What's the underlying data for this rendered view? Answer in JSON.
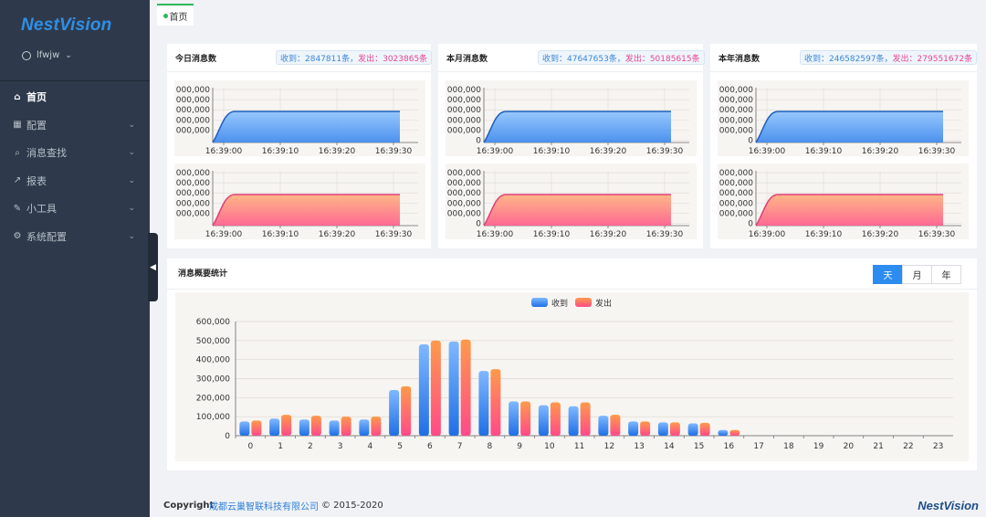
{
  "app": {
    "logo": "NestVision",
    "user": "lfwjw"
  },
  "sidebar": {
    "items": [
      {
        "label": "首页",
        "icon": "home-icon",
        "glyph": "⌂",
        "active": true,
        "chevron": false
      },
      {
        "label": "配置",
        "icon": "grid-icon",
        "glyph": "▦",
        "active": false,
        "chevron": true
      },
      {
        "label": "消息查找",
        "icon": "search-icon",
        "glyph": "⌕",
        "active": false,
        "chevron": true
      },
      {
        "label": "报表",
        "icon": "line-chart-icon",
        "glyph": "↗",
        "active": false,
        "chevron": true
      },
      {
        "label": "小工具",
        "icon": "wrench-icon",
        "glyph": "✎",
        "active": false,
        "chevron": true
      },
      {
        "label": "系统配置",
        "icon": "gear-icon",
        "glyph": "⚙",
        "active": false,
        "chevron": true
      }
    ]
  },
  "tabs": [
    {
      "label": "首页",
      "active": true
    }
  ],
  "stats": [
    {
      "title": "今日消息数",
      "received": "收到：2847811条，",
      "sent": "发出：3023865条"
    },
    {
      "title": "本月消息数",
      "received": "收到：47647653条，",
      "sent": "发出：50185615条"
    },
    {
      "title": "本年消息数",
      "received": "收到：246582597条，",
      "sent": "发出：279551672条"
    }
  ],
  "mini_charts": {
    "x_ticks": [
      "16:39:00",
      "16:39:10",
      "16:39:20",
      "16:39:30"
    ],
    "today_y_ticks": [
      "000,000",
      "000,000",
      "000,000",
      "000,000",
      "000,000"
    ],
    "month_y_ticks": [
      "000,000",
      "000,000",
      "000,000",
      "000,000",
      "000,000",
      "0"
    ],
    "year_y_ticks": [
      "000,000",
      "000,000",
      "000,000",
      "000,000",
      "000,000",
      "0"
    ],
    "colors": {
      "received": "#2f7fe8",
      "sent": "#ff7a8a"
    }
  },
  "summary": {
    "title": "消息概要统计",
    "buttons": [
      {
        "label": "天",
        "active": true
      },
      {
        "label": "月",
        "active": false
      },
      {
        "label": "年",
        "active": false
      }
    ]
  },
  "chart_data": {
    "type": "bar",
    "categories": [
      "0",
      "1",
      "2",
      "3",
      "4",
      "5",
      "6",
      "7",
      "8",
      "9",
      "10",
      "11",
      "12",
      "13",
      "14",
      "15",
      "16",
      "17",
      "18",
      "19",
      "20",
      "21",
      "22",
      "23"
    ],
    "series": [
      {
        "name": "收到",
        "color": "#3a8ef0",
        "values": [
          75000,
          90000,
          85000,
          80000,
          85000,
          240000,
          480000,
          495000,
          340000,
          180000,
          160000,
          155000,
          105000,
          75000,
          70000,
          65000,
          30000,
          0,
          0,
          0,
          0,
          0,
          0,
          0
        ]
      },
      {
        "name": "发出",
        "color": "#ff8a5c",
        "values": [
          80000,
          110000,
          105000,
          100000,
          100000,
          260000,
          500000,
          505000,
          350000,
          180000,
          175000,
          175000,
          110000,
          75000,
          70000,
          68000,
          30000,
          0,
          0,
          0,
          0,
          0,
          0,
          0
        ]
      }
    ],
    "y_ticks": [
      "0",
      "100,000",
      "200,000",
      "300,000",
      "400,000",
      "500,000",
      "600,000"
    ],
    "ylim": [
      0,
      600000
    ],
    "legend": "top-center"
  },
  "footer": {
    "copyright": "Copyright",
    "company": "成都云巢智联科技有限公司",
    "years": "© 2015-2020",
    "logo": "NestVision"
  }
}
